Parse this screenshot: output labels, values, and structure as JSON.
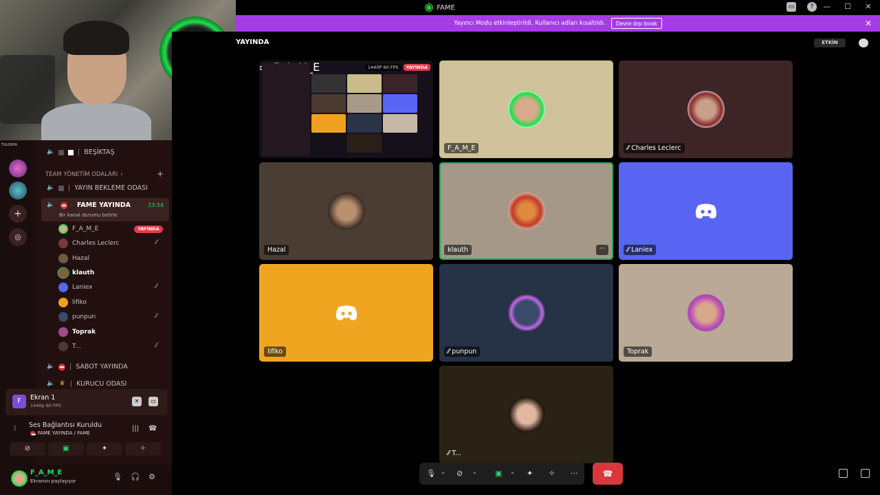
{
  "window": {
    "title": "FAME"
  },
  "banner": {
    "text": "Yayıncı Modu etkinleştirildi. Kullanıcı adları kısaltıldı.",
    "button": "Devre dışı bırak"
  },
  "header": {
    "room": "YAYINDA",
    "activity_button": "ETKİN"
  },
  "sidebar": {
    "server_tag": "TULONYA",
    "channels": {
      "besiktas": "BEŞİKTAŞ",
      "category": "TEAM YÖNETİM ODALARI",
      "waiting": "YAYIN BEKLEME ODASI",
      "active": "FAME YAYINDA",
      "active_timer": "33:54",
      "active_status": "Bir kanal durumu belirle",
      "sabot": "SABOT YAYINDA",
      "kurucu": "KURUCU ODASI"
    },
    "live_badge": "YAYINDA",
    "members": [
      "F_A_M_E",
      "Charles Leclerc",
      "Hazal",
      "klauth",
      "Laniex",
      "lifiko",
      "punpun",
      "Toprak",
      "T..."
    ]
  },
  "screen_share": {
    "title": "Ekran 1",
    "quality": "1440p 60 FPS"
  },
  "voice": {
    "status": "Ses Bağlantısı Kuruldu",
    "location": "FAME YAYINDA / FAME"
  },
  "user": {
    "name": "F_A_M_E",
    "status": "Ekranını paylaşıyor"
  },
  "stream": {
    "quality": "1440P 60 FPS",
    "live": "YAYINDA",
    "owner": "F_A_M_E"
  },
  "tiles": [
    "F_A_M_E",
    "Charles Leclerc",
    "Hazal",
    "klauth",
    "Laniex",
    "lifiko",
    "punpun",
    "Toprak",
    "T..."
  ],
  "colors": {
    "accent_purple": "#a63be8",
    "live_red": "#e23b4a",
    "discord_blurple": "#5865f2",
    "speaking_green": "#23a55a",
    "hangup_red": "#da373c"
  }
}
